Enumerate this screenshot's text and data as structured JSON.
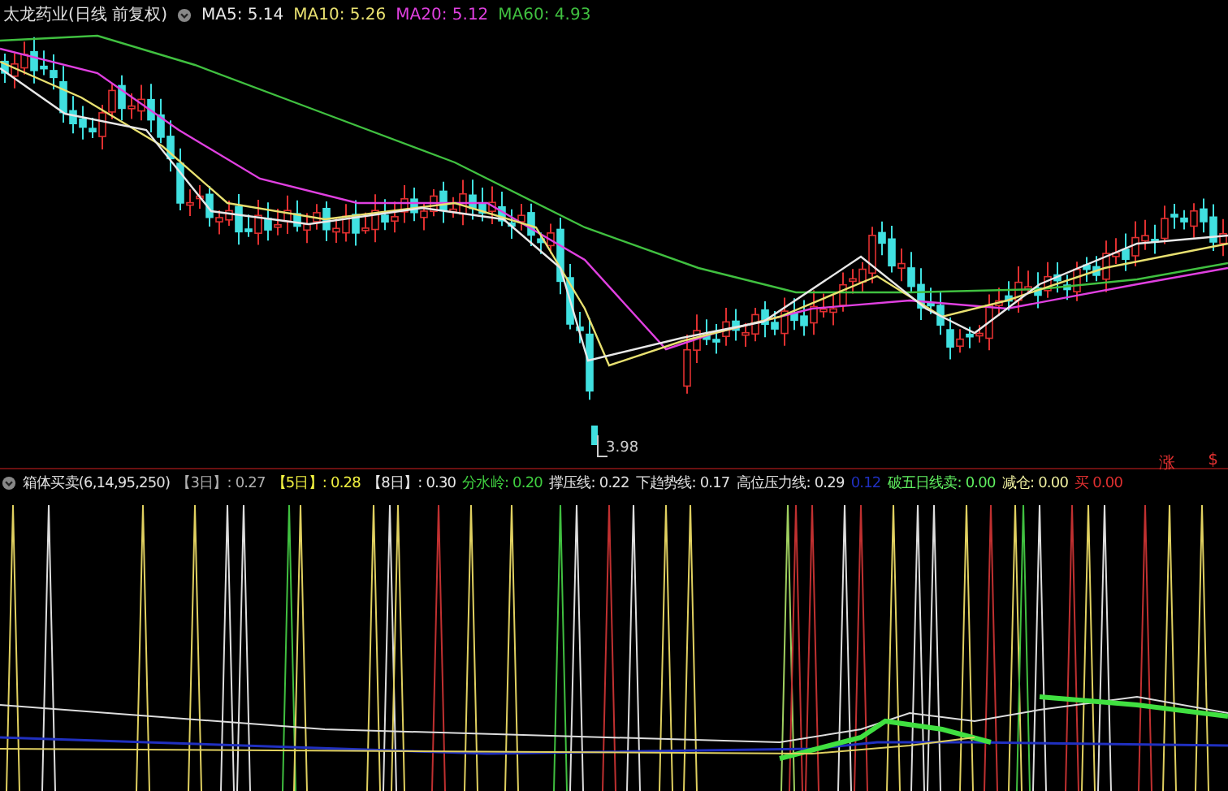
{
  "main_panel": {
    "title": "太龙药业(日线 前复权)",
    "ma": [
      {
        "label": "MA5:",
        "value": "5.14",
        "color": "#e8e8e8"
      },
      {
        "label": "MA10:",
        "value": "5.26",
        "color": "#e8e070"
      },
      {
        "label": "MA20:",
        "value": "5.12",
        "color": "#e040e0"
      },
      {
        "label": "MA60:",
        "value": "4.93",
        "color": "#40c040"
      }
    ],
    "low_label": "3.98",
    "marks": [
      {
        "text": "涨",
        "color": "#e03030"
      },
      {
        "text": "$",
        "color": "#e03030"
      }
    ]
  },
  "indicator_panel": {
    "title": "箱体买卖(6,14,95,250)",
    "items": [
      {
        "label": "【3日】:",
        "value": "0.27",
        "color": "#b0b0b0"
      },
      {
        "label": "【5日】:",
        "value": "0.28",
        "color": "#f0f040"
      },
      {
        "label": "【8日】:",
        "value": "0.30",
        "color": "#e8e8e8"
      },
      {
        "label": "分水岭:",
        "value": "0.20",
        "color": "#40d040"
      },
      {
        "label": "撑压线:",
        "value": "0.22",
        "color": "#e0e0e0"
      },
      {
        "label": "下趋势线:",
        "value": "0.17",
        "color": "#e0e0e0"
      },
      {
        "label": "高位压力线:",
        "value": "0.29",
        "color": "#e0e0e0"
      },
      {
        "value": "0.12",
        "color": "#2030c0"
      },
      {
        "label": "破五日线卖:",
        "value": "0.00",
        "color": "#60f060"
      },
      {
        "label": "减仓:",
        "value": "0.00",
        "color": "#f0f0a0"
      },
      {
        "label": "买",
        "value": "0.00",
        "color": "#e03030"
      }
    ]
  }
}
